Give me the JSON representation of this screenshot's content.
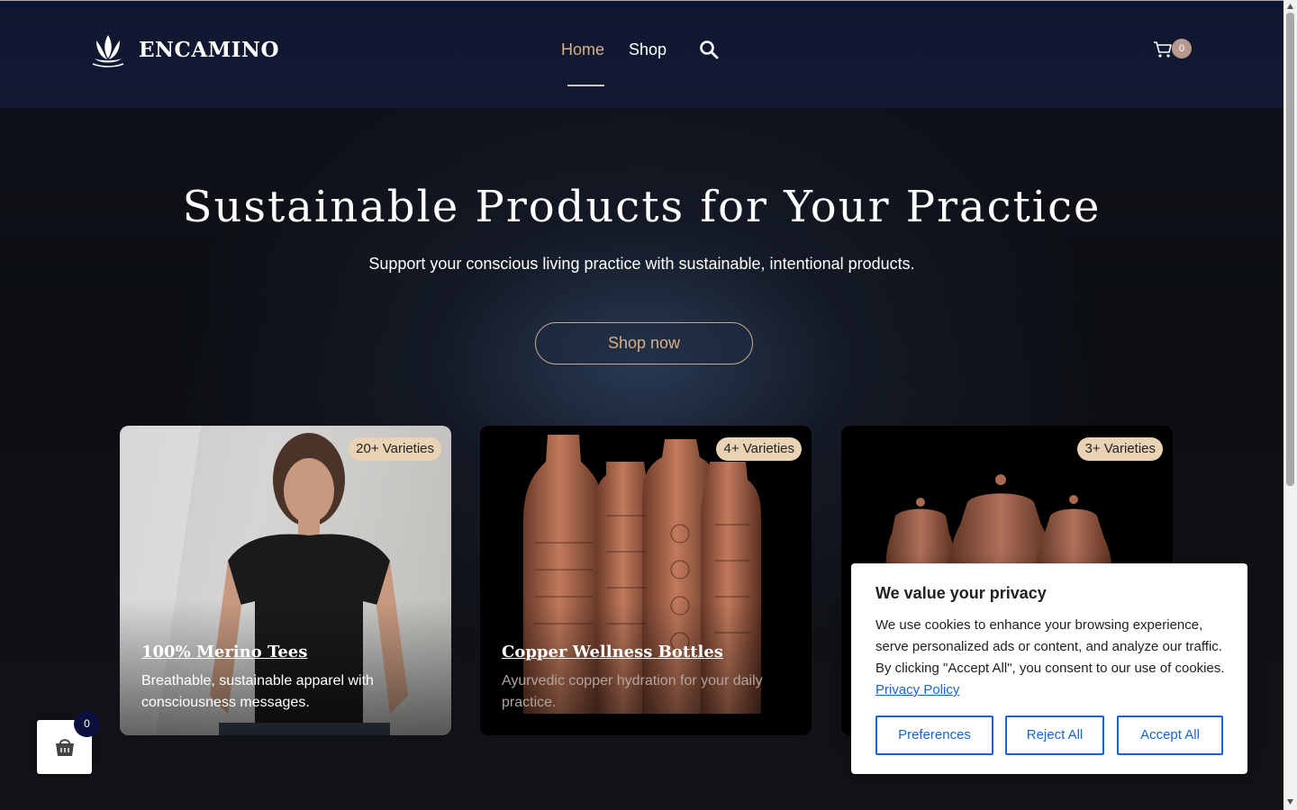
{
  "brand": {
    "name": "ENCAMINO",
    "logo_icon": "lotus-icon"
  },
  "nav": {
    "items": [
      {
        "label": "Home",
        "active": true
      },
      {
        "label": "Shop",
        "active": false
      }
    ],
    "search_icon": "search-icon"
  },
  "cart": {
    "count": "0",
    "icon": "shopping-cart-icon"
  },
  "hero": {
    "title": "Sustainable Products for Your Practice",
    "subtitle": "Support your conscious living practice with sustainable, intentional products.",
    "cta_label": "Shop now"
  },
  "cards": [
    {
      "badge": "20+ Varieties",
      "title": "100% Merino Tees",
      "description": "Breathable, sustainable apparel with consciousness messages."
    },
    {
      "badge": "4+ Varieties",
      "title": "Copper Wellness Bottles",
      "description": "Ayurvedic copper hydration for your daily practice."
    },
    {
      "badge": "3+ Varieties",
      "title": "",
      "description": ""
    }
  ],
  "floating_cart": {
    "count": "0",
    "icon": "shopping-bag-icon"
  },
  "cookie_banner": {
    "title": "We value your privacy",
    "text": "We use cookies to enhance your browsing experience, serve personalized ads or content, and analyze our traffic. By clicking \"Accept All\", you consent to our use of cookies. ",
    "link_label": "Privacy Policy",
    "buttons": {
      "preferences": "Preferences",
      "reject": "Reject All",
      "accept": "Accept All"
    }
  },
  "colors": {
    "accent_gold": "#d8b08a",
    "badge_bg": "#ead3b4",
    "cookie_blue": "#1863dc",
    "header_bg": "#0f1730"
  }
}
